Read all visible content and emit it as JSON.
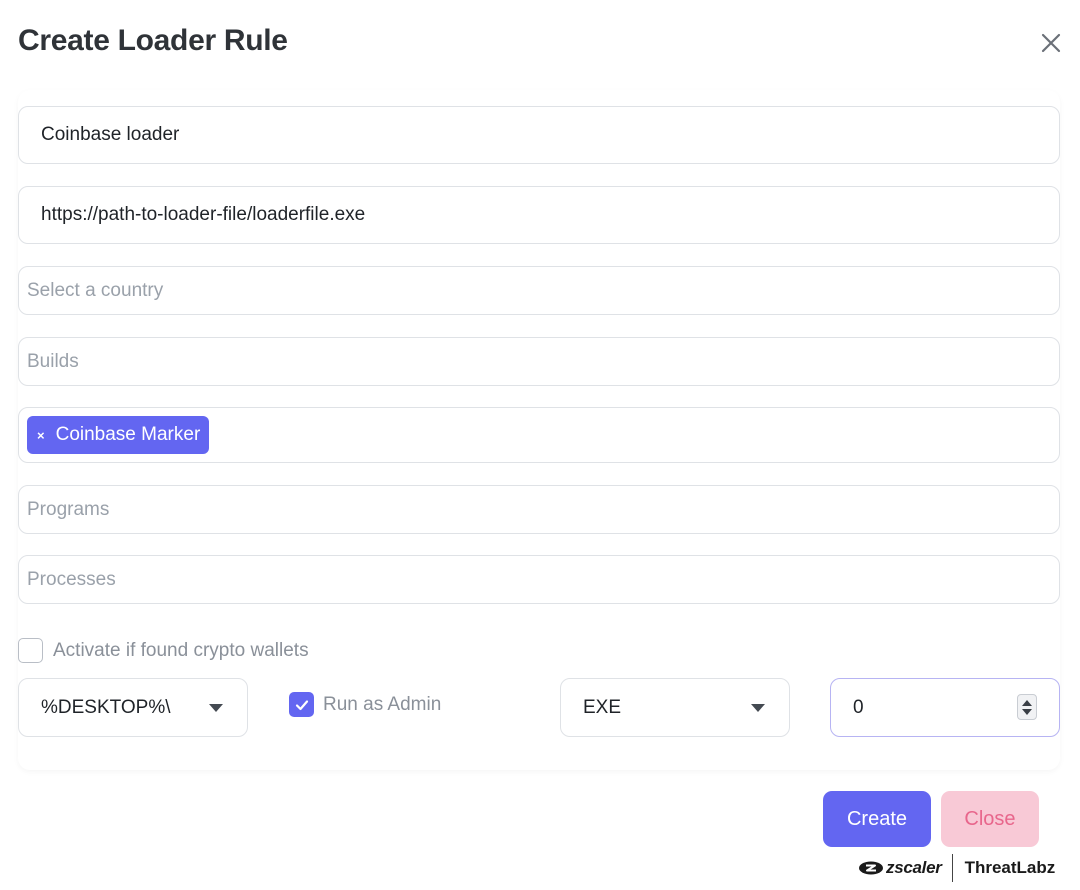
{
  "dialog": {
    "title": "Create Loader Rule"
  },
  "form": {
    "name_value": "Coinbase loader",
    "url_value": "https://path-to-loader-file/loaderfile.exe",
    "country_placeholder": "Select a country",
    "builds_placeholder": "Builds",
    "markers": [
      {
        "label": "Coinbase Marker",
        "remove": "×"
      }
    ],
    "programs_placeholder": "Programs",
    "processes_placeholder": "Processes",
    "crypto_wallets_label": "Activate if found crypto wallets",
    "crypto_wallets_checked": false,
    "path_value": "%DESKTOP%\\",
    "run_as_admin_label": "Run as Admin",
    "run_as_admin_checked": true,
    "file_type_value": "EXE",
    "number_value": "0"
  },
  "buttons": {
    "create": "Create",
    "close": "Close"
  },
  "branding": {
    "left": "zscaler",
    "right": "ThreatLabz"
  },
  "colors": {
    "accent": "#6366f1",
    "close_bg": "#f8c9d6",
    "close_text": "#e8668c"
  }
}
